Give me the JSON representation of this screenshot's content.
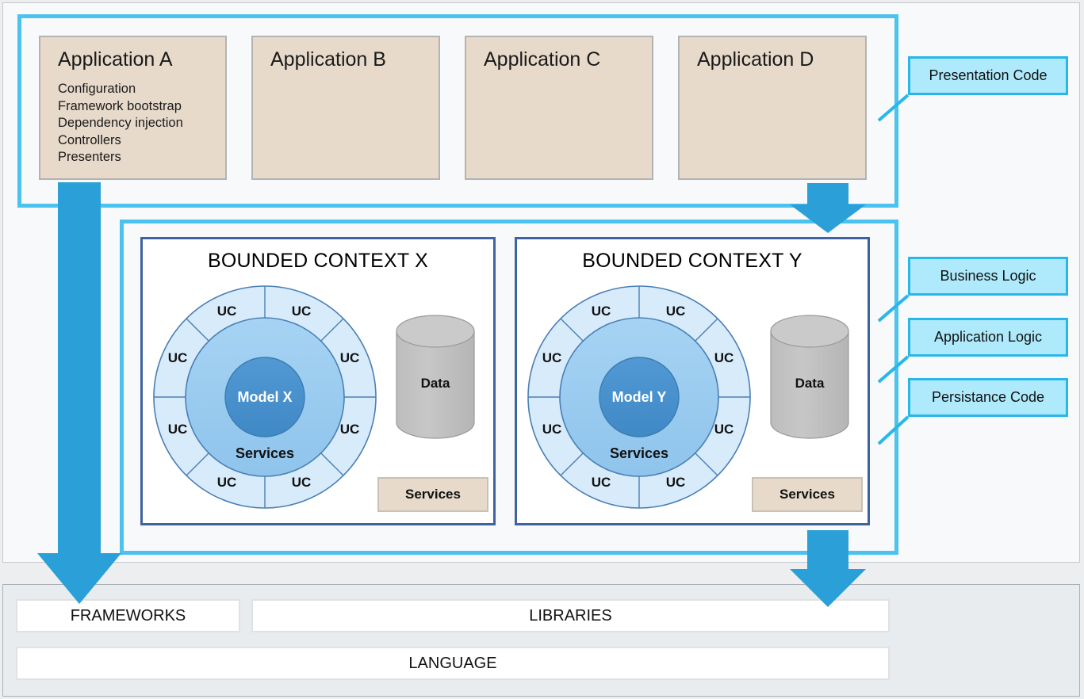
{
  "presentation": {
    "frame_label": "Presentation Code",
    "applications": [
      {
        "title": "Application A",
        "items": [
          "Configuration",
          "Framework bootstrap",
          "Dependency injection",
          "Controllers",
          "Presenters"
        ]
      },
      {
        "title": "Application B",
        "items": []
      },
      {
        "title": "Application C",
        "items": []
      },
      {
        "title": "Application D",
        "items": []
      }
    ]
  },
  "business": {
    "labels": [
      "Business Logic",
      "Application Logic",
      "Persistance Code"
    ],
    "contexts": [
      {
        "title": "BOUNDED CONTEXT X",
        "model": "Model X",
        "services_ring": "Services",
        "use_case": "UC",
        "use_case_count": 8,
        "data": "Data",
        "services_box": "Services"
      },
      {
        "title": "BOUNDED CONTEXT Y",
        "model": "Model Y",
        "services_ring": "Services",
        "use_case": "UC",
        "use_case_count": 8,
        "data": "Data",
        "services_box": "Services"
      }
    ]
  },
  "platform": {
    "frameworks": "FRAMEWORKS",
    "libraries": "LIBRARIES",
    "language": "LANGUAGE"
  },
  "colors": {
    "cyan_frame": "#4cc3ef",
    "label_fill": "#aeeafb",
    "label_border": "#28b7e8",
    "arrow": "#2a9fd8",
    "beige": "#e7dacb",
    "ring_outer": "#d6eafb",
    "ring_inner": "#9dcdf0",
    "ring_core": "#4a93d0",
    "bc_border": "#3f63a0",
    "cylinder": "#c2c2c2"
  }
}
